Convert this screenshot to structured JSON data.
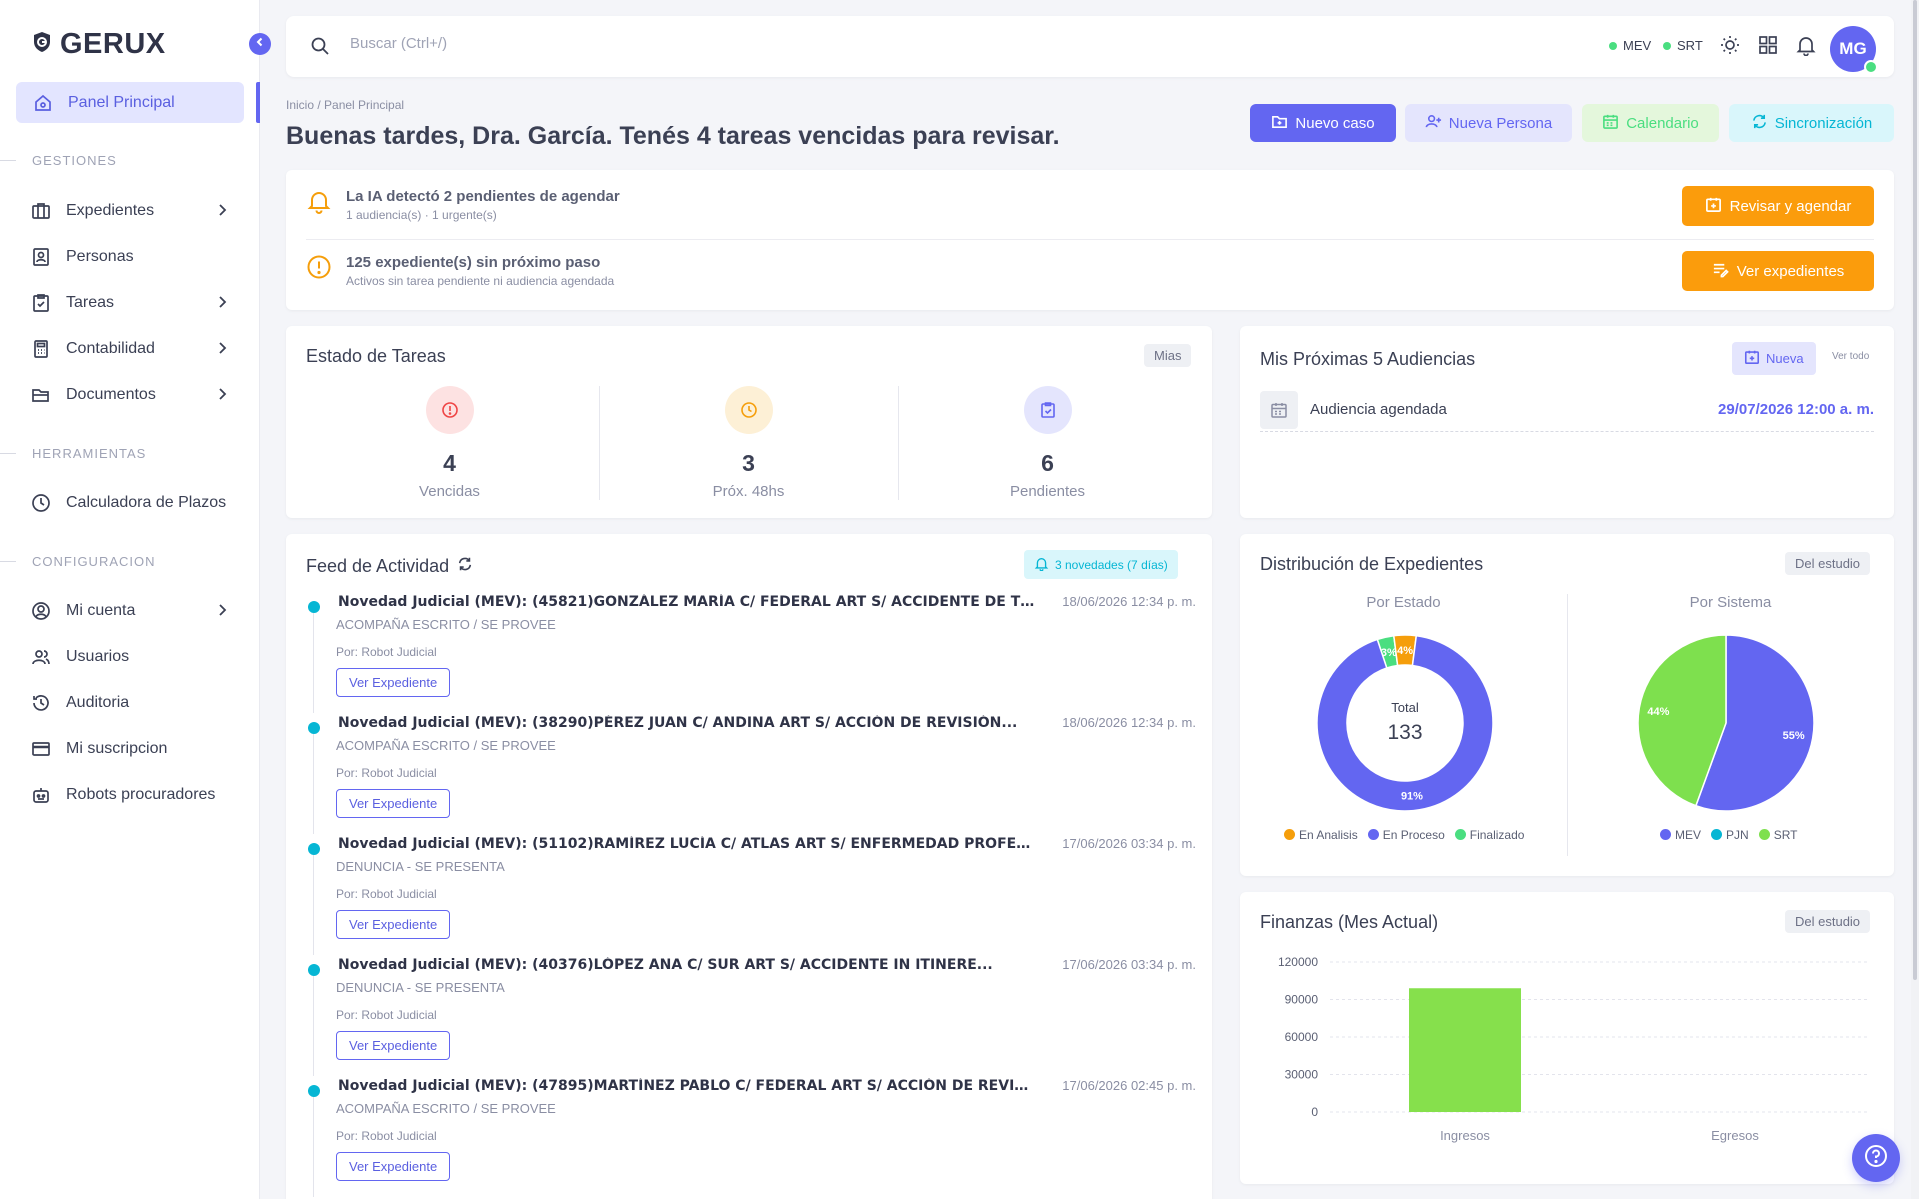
{
  "app": {
    "name": "GERUX"
  },
  "sidebar": {
    "active": {
      "label": "Panel Principal",
      "icon": "home-icon"
    },
    "sections": {
      "gestiones": "GESTIONES",
      "herramientas": "HERRAMIENTAS",
      "configuracion": "CONFIGURACION"
    },
    "items": [
      {
        "label": "Expedientes",
        "icon": "briefcase-icon",
        "chevron": true
      },
      {
        "label": "Personas",
        "icon": "contact-icon",
        "chevron": false
      },
      {
        "label": "Tareas",
        "icon": "clipboard-check-icon",
        "chevron": true
      },
      {
        "label": "Contabilidad",
        "icon": "calculator-icon",
        "chevron": true
      },
      {
        "label": "Documentos",
        "icon": "folder-open-icon",
        "chevron": true
      },
      {
        "label": "Calculadora de Plazos",
        "icon": "clock-icon",
        "chevron": false
      },
      {
        "label": "Mi cuenta",
        "icon": "user-circle-icon",
        "chevron": true
      },
      {
        "label": "Usuarios",
        "icon": "users-icon",
        "chevron": false
      },
      {
        "label": "Auditoria",
        "icon": "history-icon",
        "chevron": false
      },
      {
        "label": "Mi suscripcion",
        "icon": "credit-card-icon",
        "chevron": false
      },
      {
        "label": "Robots procuradores",
        "icon": "robot-icon",
        "chevron": false
      }
    ]
  },
  "topbar": {
    "search_placeholder": "Buscar (Ctrl+/)",
    "status": [
      {
        "label": "MEV",
        "color": "#4ade80"
      },
      {
        "label": "SRT",
        "color": "#4ade80"
      }
    ],
    "avatar_initials": "MG"
  },
  "header": {
    "breadcrumb": "Inicio / Panel Principal",
    "title": "Buenas tardes, Dra. García. Tenés 4 tareas vencidas para revisar.",
    "buttons": {
      "nuevo_caso": "Nuevo caso",
      "nueva_persona": "Nueva Persona",
      "calendario": "Calendario",
      "sincronizacion": "Sincronización"
    }
  },
  "alerts": [
    {
      "title": "La IA detectó 2 pendientes de agendar",
      "sub": "1 audiencia(s) · 1 urgente(s)",
      "action": "Revisar y agendar"
    },
    {
      "title": "125 expediente(s) sin próximo paso",
      "sub": "Activos sin tarea pendiente ni audiencia agendada",
      "action": "Ver expedientes"
    }
  ],
  "tareas": {
    "title": "Estado de Tareas",
    "tag": "Mias",
    "stats": [
      {
        "value": "4",
        "label": "Vencidas",
        "color": "#ef4444",
        "bg": "#fde2e2"
      },
      {
        "value": "3",
        "label": "Próx. 48hs",
        "color": "#f59e0b",
        "bg": "#fdf0d6"
      },
      {
        "value": "6",
        "label": "Pendientes",
        "color": "#6366f1",
        "bg": "#e4e5fd"
      }
    ]
  },
  "audiencias": {
    "title": "Mis Próximas 5 Audiencias",
    "new_label": "Nueva",
    "see_all": "Ver todo",
    "items": [
      {
        "label": "Audiencia agendada",
        "date": "29/07/2026 12:00 a. m."
      }
    ]
  },
  "feed": {
    "title": "Feed de Actividad",
    "badge": "3 novedades (7 días)",
    "by_label": "Por: Robot Judicial",
    "button_label": "Ver Expediente",
    "items": [
      {
        "title": "Novedad Judicial (MEV): (45821)GONZÁLEZ MARÍA C/ FEDERAL ART S/ ACCIDENTE DE TR...",
        "date": "18/06/2026 12:34 p. m.",
        "sub": "ACOMPAÑA ESCRITO / SE PROVEE"
      },
      {
        "title": "Novedad Judicial (MEV): (38290)PÉREZ JUAN C/ ANDINA ART S/ ACCIÓN DE REVISIÓN...",
        "date": "18/06/2026 12:34 p. m.",
        "sub": "ACOMPAÑA ESCRITO / SE PROVEE"
      },
      {
        "title": "Novedad Judicial (MEV): (51102)RAMÍREZ LUCÍA C/ ATLAS ART S/ ENFERMEDAD PROFESI...",
        "date": "17/06/2026 03:34 p. m.",
        "sub": "DENUNCIA - SE PRESENTA"
      },
      {
        "title": "Novedad Judicial (MEV): (40376)LÓPEZ ANA C/ SUR ART S/ ACCIDENTE IN ITINERE...",
        "date": "17/06/2026 03:34 p. m.",
        "sub": "DENUNCIA - SE PRESENTA"
      },
      {
        "title": "Novedad Judicial (MEV): (47895)MARTÍNEZ PABLO C/ FEDERAL ART S/ ACCIÓN DE REVISI...",
        "date": "17/06/2026 02:45 p. m.",
        "sub": "ACOMPAÑA ESCRITO / SE PROVEE"
      }
    ]
  },
  "distribucion": {
    "title": "Distribución de Expedientes",
    "tag": "Del estudio",
    "donut_title": "Por Estado",
    "pie_title": "Por Sistema",
    "total_label": "Total",
    "total_value": "133"
  },
  "finanzas": {
    "title": "Finanzas (Mes Actual)",
    "tag": "Del estudio"
  },
  "chart_data": [
    {
      "type": "pie",
      "title": "Por Estado",
      "categories": [
        "En Analisis",
        "En Proceso",
        "Finalizado"
      ],
      "values": [
        4,
        91,
        3
      ],
      "labels": [
        "4%",
        "91%",
        "3%"
      ],
      "colors": [
        "#f59e0b",
        "#6366f1",
        "#4ade80"
      ],
      "legend": "bottom"
    },
    {
      "type": "pie",
      "title": "Por Sistema",
      "categories": [
        "MEV",
        "PJN",
        "SRT"
      ],
      "values": [
        55,
        0,
        44
      ],
      "labels": [
        "55%",
        "",
        "44%"
      ],
      "colors": [
        "#6366f1",
        "#06b6d4",
        "#7ee04e"
      ],
      "legend": "bottom"
    },
    {
      "type": "bar",
      "title": "Finanzas (Mes Actual)",
      "categories": [
        "Ingresos",
        "Egresos"
      ],
      "values": [
        99000,
        0
      ],
      "ylim": [
        0,
        120000
      ],
      "yticks": [
        0,
        30000,
        60000,
        90000,
        120000
      ],
      "color": "#86e04c",
      "grid": true
    }
  ]
}
